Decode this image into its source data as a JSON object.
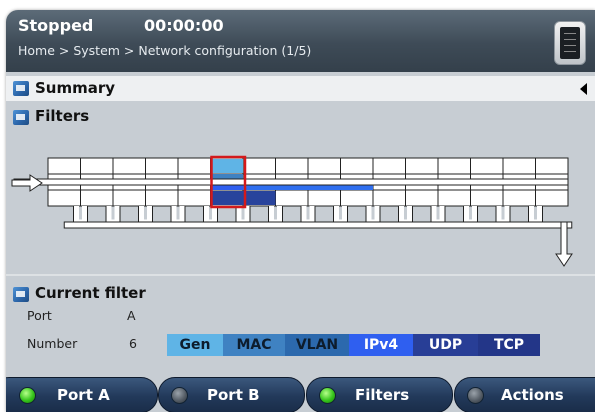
{
  "header": {
    "status": "Stopped",
    "timer": "00:00:00",
    "breadcrumb": "Home > System > Network configuration (1/5)",
    "help_icon": "book-icon"
  },
  "sections": {
    "summary": {
      "label": "Summary",
      "icon": "panel-icon"
    },
    "filters": {
      "label": "Filters",
      "icon": "panel-icon"
    }
  },
  "current_filter": {
    "title": "Current filter",
    "port_label": "Port",
    "port_value": "A",
    "number_label": "Number",
    "number_value": "6",
    "protocols": [
      {
        "label": "Gen",
        "bg": "#5fb4e6",
        "fg": "#0d1c2c"
      },
      {
        "label": "MAC",
        "bg": "#3f82c2",
        "fg": "#0d1c2c"
      },
      {
        "label": "VLAN",
        "bg": "#2c69ad",
        "fg": "#0d1c2c"
      },
      {
        "label": "IPv4",
        "bg": "#2f5ff0",
        "fg": "#ffffff"
      },
      {
        "label": "UDP",
        "bg": "#283e96",
        "fg": "#ffffff"
      },
      {
        "label": "TCP",
        "bg": "#233688",
        "fg": "#ffffff"
      }
    ]
  },
  "filter_chain": {
    "slots": 16,
    "selected_slot": 6
  },
  "bottom_buttons": [
    {
      "label": "Port A",
      "led": "on"
    },
    {
      "label": "Port B",
      "led": "off"
    },
    {
      "label": "Filters",
      "led": "on"
    },
    {
      "label": "Actions",
      "led": "off"
    }
  ],
  "colors": {
    "topbar": "#3e4b57",
    "selection_outline": "#d3191c",
    "path_highlight": "#2f6ff0"
  }
}
